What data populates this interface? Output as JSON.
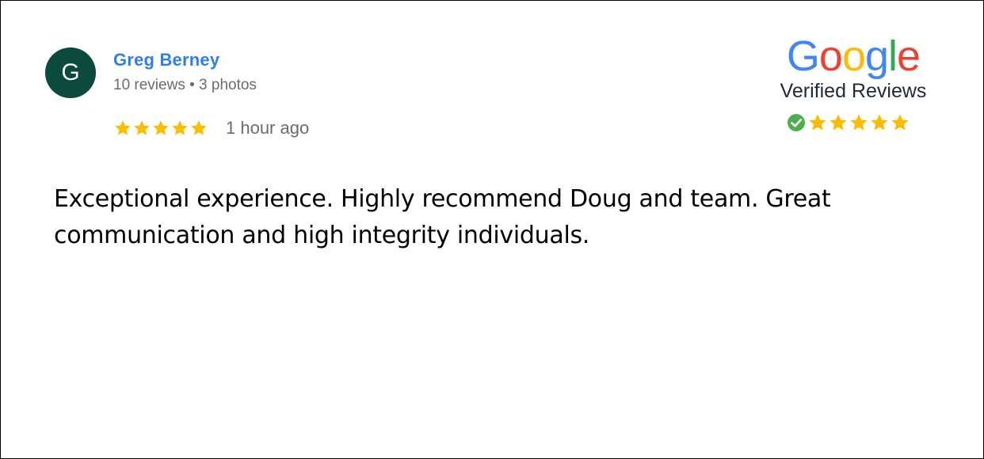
{
  "review": {
    "avatar_initial": "G",
    "reviewer_name": "Greg Berney",
    "reviewer_meta": "10 reviews • 3 photos",
    "rating": 5,
    "time_ago": "1 hour ago",
    "text": "Exceptional experience. Highly recommend Doug and team. Great communication and high integrity individuals."
  },
  "badge": {
    "brand": "Google",
    "brand_letters": [
      {
        "ch": "G",
        "color": "#4285F4"
      },
      {
        "ch": "o",
        "color": "#EA4335"
      },
      {
        "ch": "o",
        "color": "#FBBC05"
      },
      {
        "ch": "g",
        "color": "#4285F4"
      },
      {
        "ch": "l",
        "color": "#34A853"
      },
      {
        "ch": "e",
        "color": "#EA4335"
      }
    ],
    "caption": "Verified Reviews",
    "rating": 5,
    "check_icon": "check-circle-icon"
  },
  "colors": {
    "avatar_bg": "#0b4a3c",
    "name": "#2f7fe8",
    "star": "#fbbc04",
    "check": "#4caf50"
  }
}
